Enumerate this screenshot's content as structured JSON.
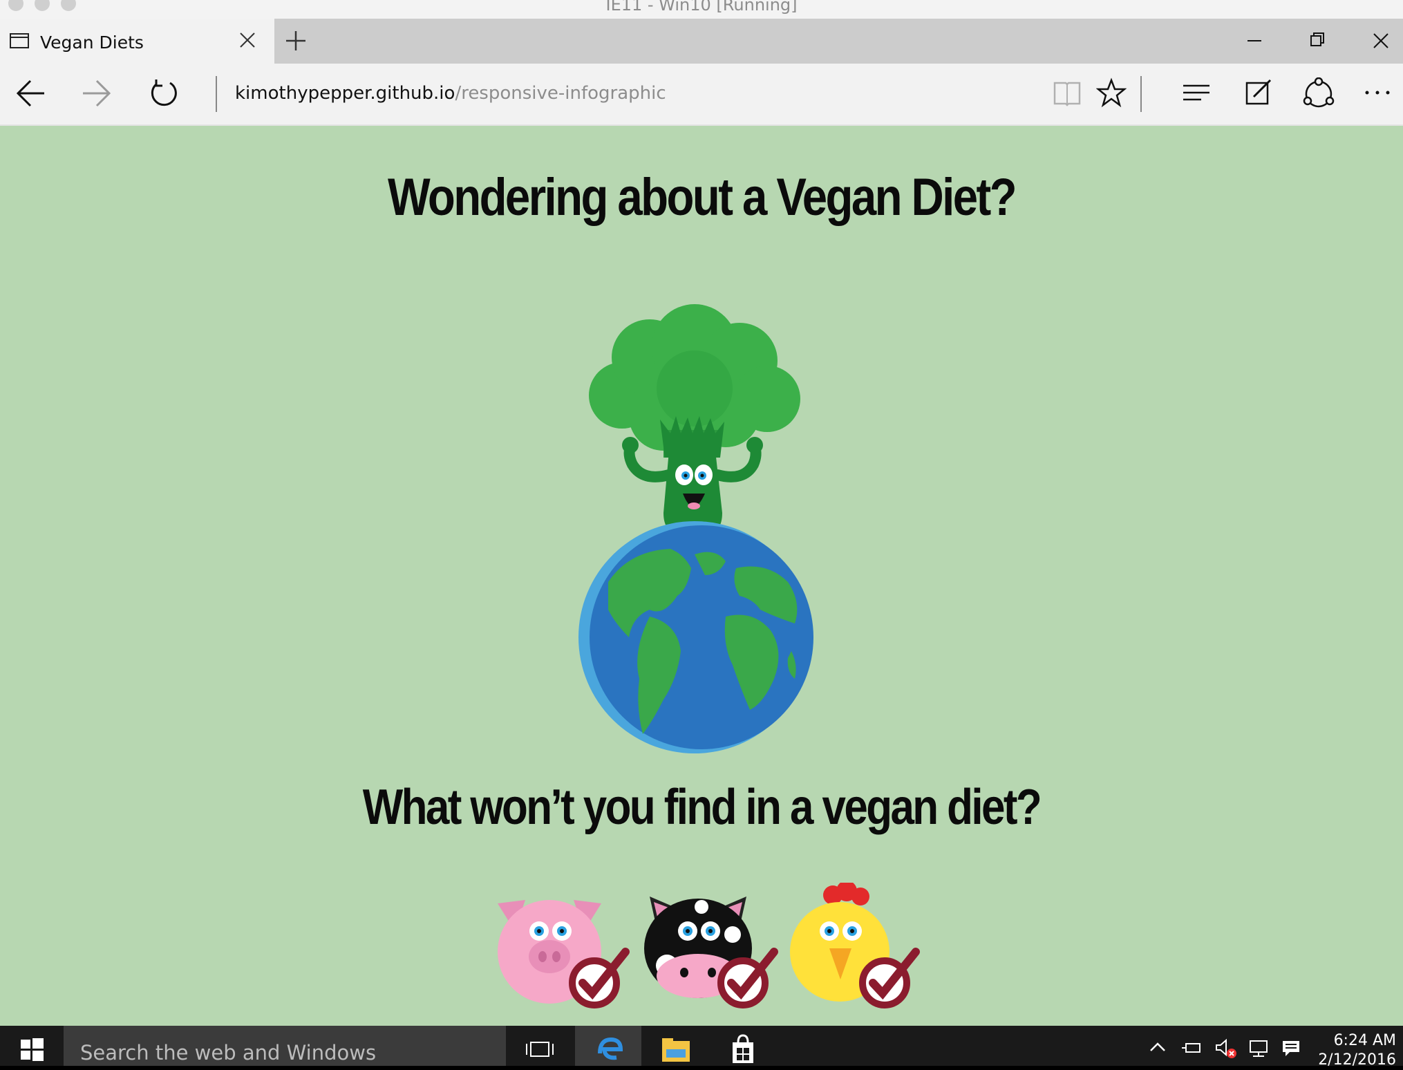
{
  "vm_window": {
    "title": "IE11 - Win10 [Running]"
  },
  "browser": {
    "tab_title": "Vegan Diets",
    "address_host": "kimothypepper.github.io",
    "address_path": "/responsive-infographic"
  },
  "page": {
    "heading": "Wondering about a Vegan Diet?",
    "subheading": "What won’t you find in a vegan diet?"
  },
  "taskbar": {
    "search_placeholder": "Search the web and Windows",
    "time": "6:24 AM",
    "date": "2/12/2016"
  },
  "colors": {
    "page_bg": "#b7d7b1",
    "broccoli": "#3cb04a",
    "ocean": "#2a74c0",
    "check": "#8b1c2e"
  }
}
